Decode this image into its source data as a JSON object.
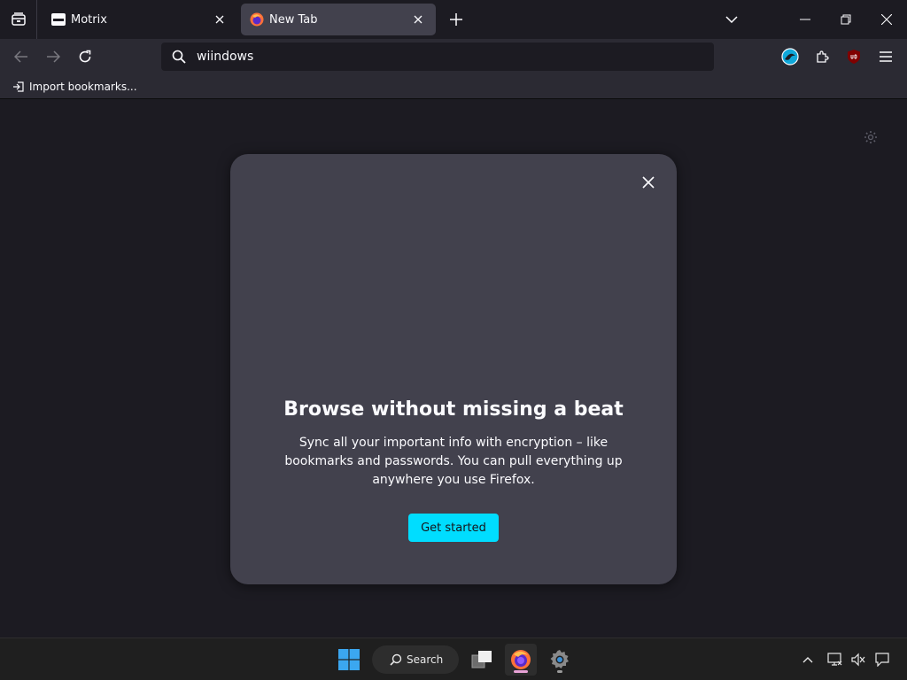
{
  "browser": {
    "tabs": [
      {
        "label": "Motrix",
        "icon": "motrix-icon",
        "active": false
      },
      {
        "label": "New Tab",
        "icon": "firefox-icon",
        "active": true
      }
    ],
    "url_value": "wiindows",
    "bookmarks": {
      "import_label": "Import bookmarks..."
    }
  },
  "dialog": {
    "title": "Browse without missing a beat",
    "body": "Sync all your important info with encryption – like bookmarks and passwords. You can pull everything up anywhere you use Firefox.",
    "cta_label": "Get started"
  },
  "taskbar": {
    "search_label": "Search"
  },
  "colors": {
    "accent": "#00ddff",
    "chrome": "#2b2a33",
    "content_bg": "#1c1b22",
    "dialog_bg": "#42414d"
  }
}
